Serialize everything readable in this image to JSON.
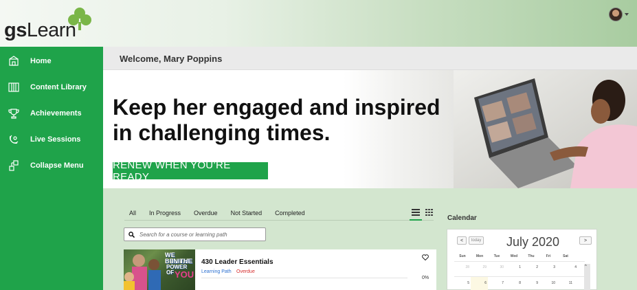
{
  "brand": {
    "name_bold": "gs",
    "name_rest": "Learn",
    "green": "#1fa34a"
  },
  "user_menu": {
    "icon": "user-avatar-icon"
  },
  "sidebar": {
    "items": [
      {
        "label": "Home",
        "icon": "home-icon"
      },
      {
        "label": "Content Library",
        "icon": "library-icon"
      },
      {
        "label": "Achievements",
        "icon": "trophy-icon"
      },
      {
        "label": "Live Sessions",
        "icon": "live-sessions-icon"
      },
      {
        "label": "Collapse Menu",
        "icon": "collapse-menu-icon"
      }
    ]
  },
  "welcome": {
    "text": "Welcome, Mary Poppins"
  },
  "banner": {
    "headline_line1": "Keep her engaged and inspired",
    "headline_line2": "in challenging times.",
    "cta": "RENEW WHEN YOU’RE READY"
  },
  "filters": {
    "tabs": [
      "All",
      "In Progress",
      "Overdue",
      "Not Started",
      "Completed"
    ],
    "view_icons": [
      "list-view-icon",
      "grid-view-icon"
    ]
  },
  "search": {
    "placeholder": "Search for a course or learning path"
  },
  "courses": [
    {
      "title": "430 Leader Essentials",
      "type": "Learning Path",
      "status": "Overdue",
      "progress": "0%",
      "progress_value": 0,
      "thumb_text": [
        "WE BELIEVE",
        "IN THE",
        "POWER OF",
        "YOU"
      ],
      "status_color": "#d62c2c",
      "type_color": "#2a6fd0"
    }
  ],
  "calendar": {
    "heading": "Calendar",
    "today_label": "today",
    "prev_label": "<",
    "next_label": ">",
    "month": "July 2020",
    "weekdays": [
      "Sun",
      "Mon",
      "Tue",
      "Wed",
      "Thu",
      "Fri",
      "Sat"
    ],
    "week1": [
      "28",
      "29",
      "30",
      "1",
      "2",
      "3",
      "4"
    ],
    "week2": [
      "5",
      "6",
      "7",
      "8",
      "9",
      "10",
      "11"
    ],
    "scroll_up": "^"
  }
}
